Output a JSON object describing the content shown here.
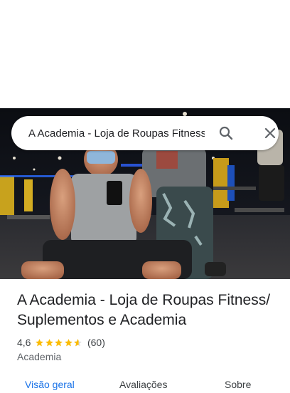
{
  "search": {
    "query": "A Academia - Loja de Roupas Fitness/ Suplementos e Academia",
    "search_icon": "search-icon",
    "close_icon": "close-icon"
  },
  "place": {
    "title": "A Academia - Loja de Roupas Fitness/ Suplementos e Academia",
    "rating": "4,6",
    "stars": 4.6,
    "reviews": "(60)",
    "category": "Academia"
  },
  "tabs": [
    {
      "label": "Visão geral",
      "active": true
    },
    {
      "label": "Avaliações",
      "active": false
    },
    {
      "label": "Sobre",
      "active": false
    }
  ],
  "colors": {
    "accent": "#1a73e8",
    "star": "#fbbc04",
    "text": "#202124"
  }
}
